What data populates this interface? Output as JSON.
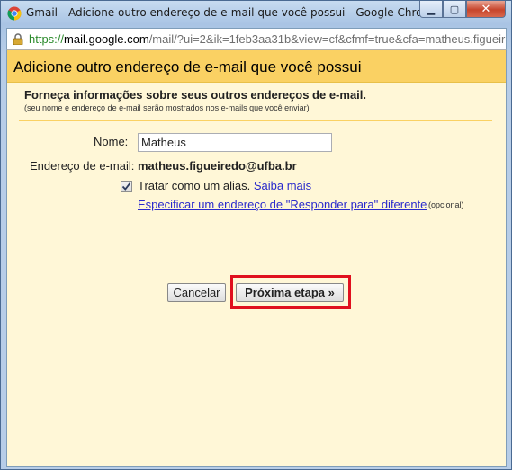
{
  "window": {
    "title": "Gmail - Adicione outro endereço de e-mail que você possui - Google Chrome",
    "controls": {
      "minimize": "▁",
      "maximize": "▢",
      "close": "✕"
    }
  },
  "address_bar": {
    "scheme": "https://",
    "host": "mail.google.com",
    "path": "/mail/?ui=2&ik=1feb3aa31b&view=cf&cfmf=true&cfa=matheus.figueired"
  },
  "dialog": {
    "title": "Adicione outro endereço de e-mail que você possui",
    "intro_title": "Forneça informações sobre seus outros endereços de e-mail.",
    "intro_sub": "(seu nome e endereço de e-mail serão mostrados nos e-mails que você enviar)",
    "name_label": "Nome:",
    "name_value": "Matheus",
    "email_label": "Endereço de e-mail:",
    "email_value": "matheus.figueiredo@ufba.br",
    "alias_label": "Tratar como um alias.",
    "alias_checked": true,
    "learn_more": "Saiba mais",
    "reply_to_link": "Especificar um endereço de \"Responder para\" diferente",
    "optional": "(opcional)",
    "cancel_button": "Cancelar",
    "next_button": "Próxima etapa »"
  },
  "colors": {
    "header": "#fad163",
    "body": "#fff7d7",
    "highlight": "#e0101e",
    "link": "#2a2acc"
  },
  "icons": {
    "browser": "chrome-logo-icon",
    "secure": "lock-icon",
    "check": "checkmark-icon"
  }
}
